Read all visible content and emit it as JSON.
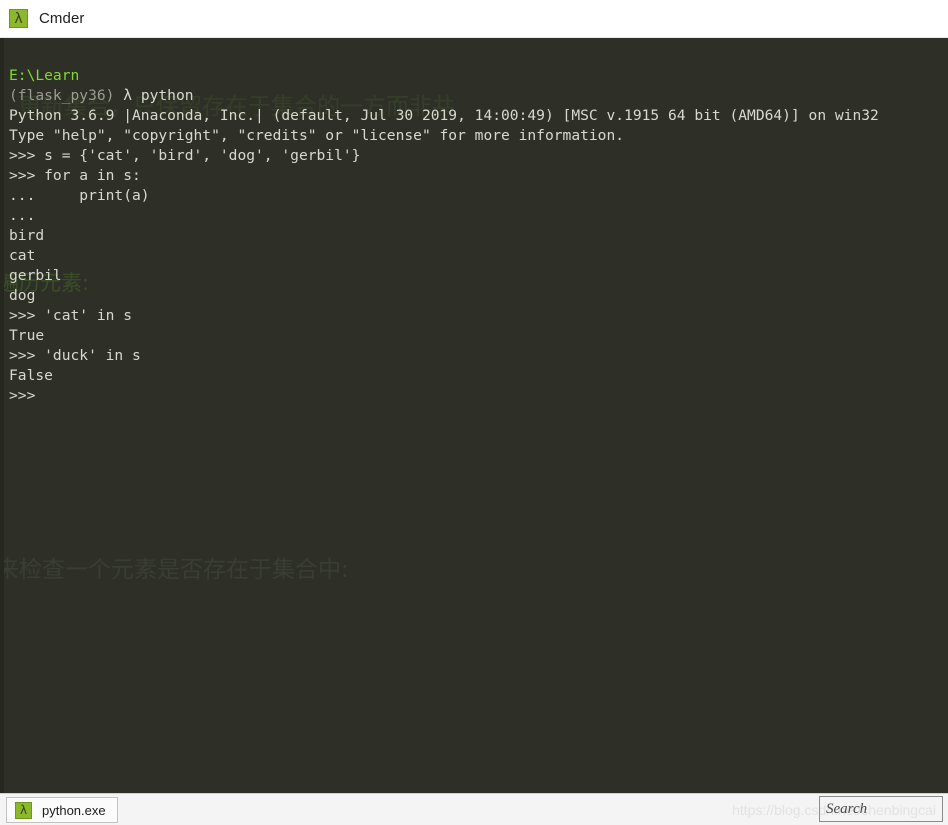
{
  "window": {
    "title": "Cmder",
    "icon": "lambda-icon",
    "icon_glyph": "λ"
  },
  "colors": {
    "terminal_background": "#2e3028",
    "terminal_foreground": "#d8d8cf",
    "prompt_path_green": "#7ddc2a",
    "env_gray": "#9b9b93",
    "accent_green": "#8cb82b",
    "statusbar_background": "#f4f4f4"
  },
  "terminal": {
    "lines": [
      {
        "text": "E:\\Learn",
        "color": "green"
      },
      {
        "text": "(flask_py36) λ python",
        "color": "mixed"
      },
      {
        "text": "Python 3.6.9 |Anaconda, Inc.| (default, Jul 30 2019, 14:00:49) [MSC v.1915 64 bit (AMD64)] on win32",
        "color": "default"
      },
      {
        "text": "Type \"help\", \"copyright\", \"credits\" or \"license\" for more information.",
        "color": "default"
      },
      {
        "text": ">>> s = {'cat', 'bird', 'dog', 'gerbil'}",
        "color": "default"
      },
      {
        "text": ">>> for a in s:",
        "color": "default"
      },
      {
        "text": "...     print(a)",
        "color": "default"
      },
      {
        "text": "...",
        "color": "default"
      },
      {
        "text": "bird",
        "color": "default"
      },
      {
        "text": "cat",
        "color": "default"
      },
      {
        "text": "gerbil",
        "color": "default"
      },
      {
        "text": "dog",
        "color": "default"
      },
      {
        "text": ">>> 'cat' in s",
        "color": "default"
      },
      {
        "text": "True",
        "color": "default"
      },
      {
        "text": ">>> 'duck' in s",
        "color": "default"
      },
      {
        "text": "False",
        "color": "default"
      },
      {
        "text": ">>>",
        "color": "default"
      }
    ],
    "prompt_line": {
      "path": "E:\\Learn",
      "env": "(flask_py36)",
      "lambda": "λ",
      "command": "python"
    }
  },
  "watermarks": {
    "top": "更新集合，只保留存在于集合的一方而非共",
    "middle": "遍历元素:",
    "lower": "来检查一个元素是否存在于集合中:",
    "statusbar_url": "https://blog.csdn.net/chenbingcai"
  },
  "statusbar": {
    "tab": {
      "label": "python.exe",
      "icon_glyph": "λ"
    },
    "search": {
      "placeholder": "Search",
      "value": ""
    }
  }
}
